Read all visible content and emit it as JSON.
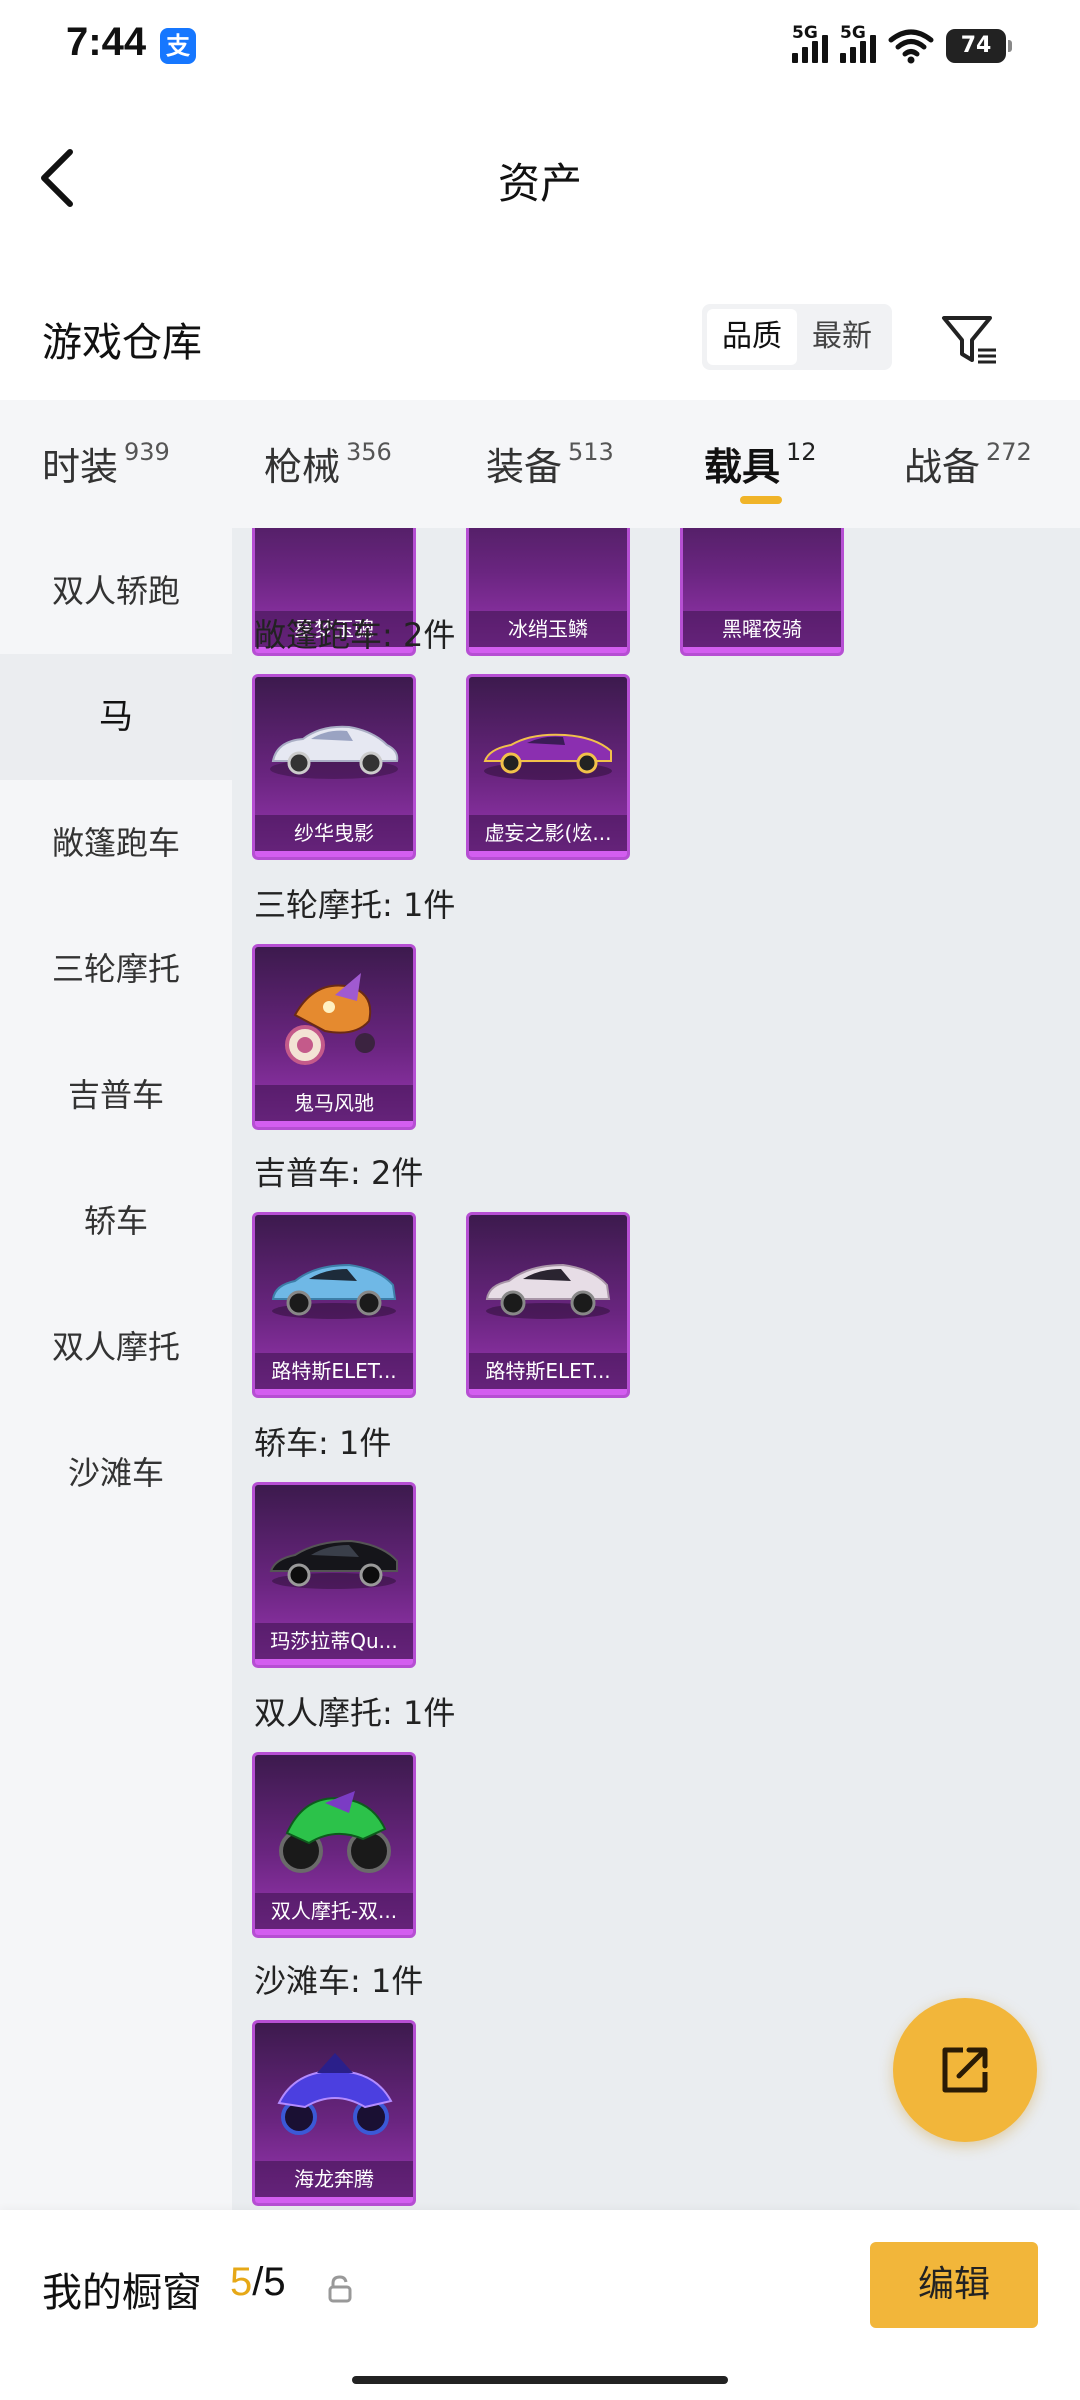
{
  "status_bar": {
    "time": "7:44",
    "alipay_glyph": "支",
    "signal_1": "5G",
    "signal_2": "5G",
    "battery": "74"
  },
  "header": {
    "title": "资产"
  },
  "warehouse": {
    "title": "游戏仓库",
    "sort_options": [
      "品质",
      "最新"
    ],
    "sort_selected": "品质"
  },
  "tabs": [
    {
      "label": "时装",
      "count": "939"
    },
    {
      "label": "枪械",
      "count": "356"
    },
    {
      "label": "装备",
      "count": "513"
    },
    {
      "label": "载具",
      "count": "12",
      "active": true
    },
    {
      "label": "战备",
      "count": "272"
    }
  ],
  "subnav": [
    {
      "label": "双人轿跑"
    },
    {
      "label": "马",
      "active": true
    },
    {
      "label": "敞篷跑车"
    },
    {
      "label": "三轮摩托"
    },
    {
      "label": "吉普车"
    },
    {
      "label": "轿车"
    },
    {
      "label": "双人摩托"
    },
    {
      "label": "沙滩车"
    }
  ],
  "sections": {
    "horse_partial": [
      "星梦玉骢",
      "冰绡玉鳞",
      "黑曜夜骑"
    ],
    "convertible": {
      "title": "敞篷跑车: 2件",
      "items": [
        "纱华曳影",
        "虚妄之影(炫..."
      ]
    },
    "trike": {
      "title": "三轮摩托: 1件",
      "items": [
        "鬼马风驰"
      ]
    },
    "jeep": {
      "title": "吉普车: 2件",
      "items": [
        "路特斯ELET...",
        "路特斯ELET..."
      ]
    },
    "sedan": {
      "title": "轿车: 1件",
      "items": [
        "玛莎拉蒂Qu..."
      ]
    },
    "moto": {
      "title": "双人摩托: 1件",
      "items": [
        "双人摩托-双..."
      ]
    },
    "beach": {
      "title": "沙滩车: 1件",
      "items": [
        "海龙奔腾"
      ]
    }
  },
  "bottom_bar": {
    "label": "我的橱窗",
    "used": "5",
    "slash_total": "/5",
    "edit_label": "编辑"
  },
  "colors": {
    "accent": "#f2b63a",
    "card_purple": "#6a2580",
    "card_border": "#b64fd3",
    "content_bg": "#eaedf0",
    "nav_bg": "#f5f6f8"
  },
  "icons": [
    "alipay-icon",
    "wifi-icon",
    "back-arrow-icon",
    "filter-icon",
    "share-external-icon",
    "lock-icon"
  ]
}
